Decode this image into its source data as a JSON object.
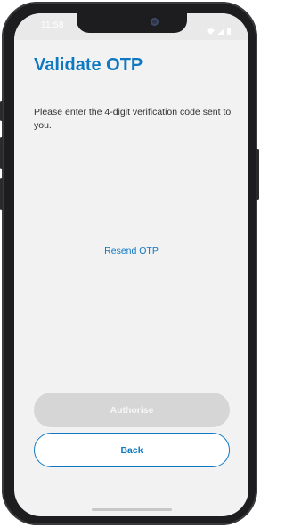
{
  "status_bar": {
    "time": "11:58"
  },
  "screen": {
    "title": "Validate OTP",
    "instruction": "Please enter the 4-digit verification code sent to you.",
    "otp_slots": [
      "",
      "",
      "",
      ""
    ],
    "resend_label": "Resend OTP"
  },
  "actions": {
    "authorise_label": "Authorise",
    "back_label": "Back"
  },
  "colors": {
    "accent": "#0f78c2",
    "disabled_button": "#d6d6d6",
    "background": "#f2f2f2"
  },
  "icons": [
    "wifi-icon",
    "signal-icon",
    "battery-icon"
  ]
}
